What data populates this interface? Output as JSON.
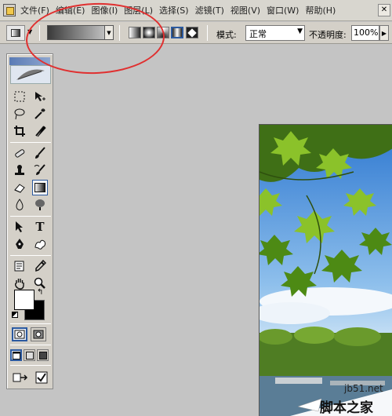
{
  "menubar": {
    "items": [
      "文件(F)",
      "编辑(E)",
      "图像(I)",
      "图层(L)",
      "选择(S)",
      "滤镜(T)",
      "视图(V)",
      "窗口(W)",
      "帮助(H)"
    ]
  },
  "options": {
    "mode_label": "模式:",
    "mode_value": "正常",
    "opacity_label": "不透明度:",
    "opacity_value": "100%",
    "gradient_types": [
      "linear-gradient-icon",
      "radial-gradient-icon",
      "angle-gradient-icon",
      "reflected-gradient-icon",
      "diamond-gradient-icon"
    ],
    "active_gradient_type": "reflected-gradient-icon"
  },
  "toolbox": {
    "tools": [
      [
        "marquee-icon",
        "move-icon"
      ],
      [
        "lasso-icon",
        "magic-wand-icon"
      ],
      [
        "crop-icon",
        "slice-icon"
      ],
      [
        "healing-brush-icon",
        "brush-icon"
      ],
      [
        "clone-stamp-icon",
        "history-brush-icon"
      ],
      [
        "eraser-icon",
        "gradient-icon"
      ],
      [
        "blur-icon",
        "dodge-icon"
      ],
      [
        "path-selection-icon",
        "type-icon"
      ],
      [
        "pen-icon",
        "custom-shape-icon"
      ],
      [
        "notes-icon",
        "eyedropper-icon"
      ],
      [
        "hand-icon",
        "zoom-icon"
      ]
    ],
    "selected_tool": "gradient-icon",
    "foreground_color": "#ffffff",
    "background_color": "#000000"
  },
  "watermark": {
    "url": "jb51.net",
    "name": "脚本之家"
  },
  "colors": {
    "annotation": "#e03030",
    "sky": "#3f86d8",
    "leaves": "#6b9a1e"
  }
}
